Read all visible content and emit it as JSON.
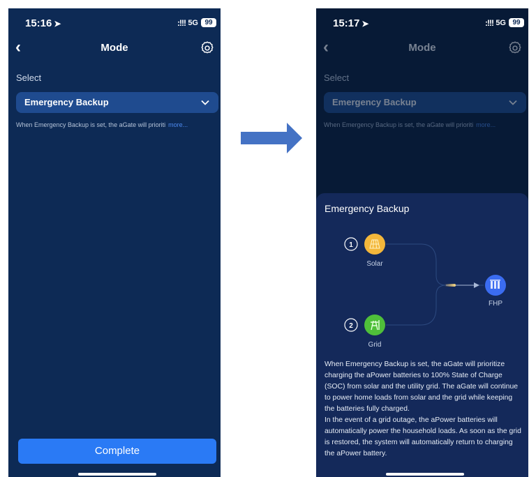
{
  "left": {
    "status": {
      "time": "15:16",
      "signal": ":!!!",
      "network": "5G",
      "battery": "99"
    },
    "nav": {
      "title": "Mode",
      "back": "‹"
    },
    "select_label": "Select",
    "dropdown_value": "Emergency Backup",
    "hint_text": "When Emergency Backup is set, the aGate will prioriti",
    "hint_more": "more...",
    "complete_label": "Complete"
  },
  "right": {
    "status": {
      "time": "15:17",
      "signal": ":!!!",
      "network": "5G",
      "battery": "99"
    },
    "nav": {
      "title": "Mode",
      "back": "‹"
    },
    "select_label": "Select",
    "dropdown_value": "Emergency Backup",
    "hint_text": "When Emergency Backup is set, the aGate will prioriti",
    "hint_more": "more...",
    "sheet": {
      "title": "Emergency Backup",
      "diagram": {
        "solar": {
          "number": "1",
          "label": "Solar"
        },
        "grid": {
          "number": "2",
          "label": "Grid"
        },
        "fhp": {
          "label": "FHP"
        }
      },
      "description_1": "When Emergency Backup is set, the aGate will prioritize charging the aPower batteries to 100% State of Charge (SOC) from solar and the utility grid. The aGate will continue to power home loads from solar and the grid while keeping the batteries fully charged.",
      "description_2": "In the event of a grid outage, the aPower batteries will automatically power the household loads. As soon as the grid is restored, the system will automatically return to charging the aPower battery."
    }
  },
  "colors": {
    "accent": "#2a7af5",
    "solar": "#f3b73b",
    "grid": "#4fbf3a",
    "fhp": "#3b6cf0",
    "arrow": "#4472c4"
  },
  "icons": [
    "location-arrow-icon",
    "back-icon",
    "gear-icon",
    "chevron-down-icon",
    "solar-panel-icon",
    "grid-tower-icon",
    "battery-icon",
    "right-arrow-icon"
  ]
}
